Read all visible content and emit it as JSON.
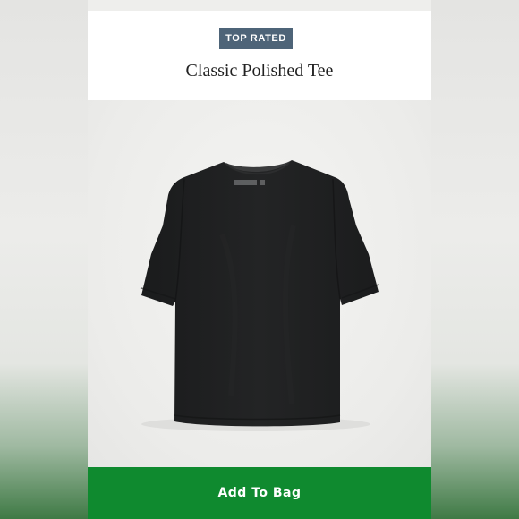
{
  "product": {
    "badge": "TOP RATED",
    "title": "Classic Polished Tee",
    "image_icon": "tshirt-icon",
    "garment_color": "#1f2021"
  },
  "actions": {
    "add_to_bag_label": "Add To Bag"
  },
  "colors": {
    "badge_bg": "#4e6478",
    "button_bg": "#0f8a2f",
    "header_bg": "#ffffff"
  }
}
